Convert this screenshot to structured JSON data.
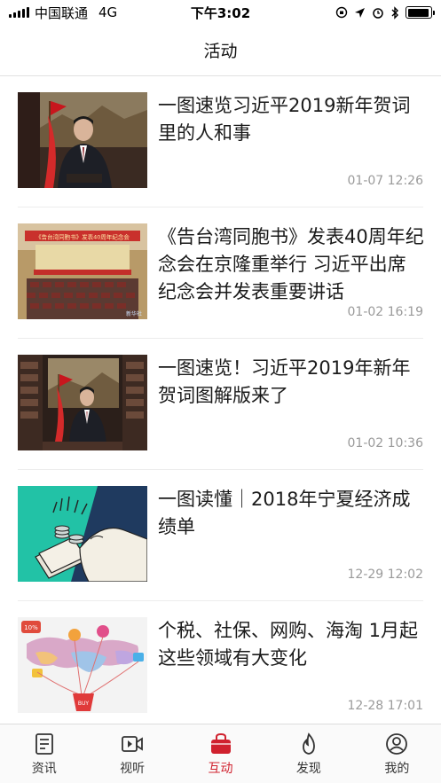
{
  "status_bar": {
    "carrier": "中国联通",
    "network": "4G",
    "time": "下午3:02",
    "battery_level": 0.95
  },
  "header": {
    "title": "活动"
  },
  "articles": [
    {
      "title": "一图速览习近平2019新年贺词里的人和事",
      "time": "01-07 12:26",
      "thumb_icon": "speech-photo"
    },
    {
      "title": "《告台湾同胞书》发表40周年纪念会在京隆重举行 习近平出席纪念会并发表重要讲话",
      "time": "01-02 16:19",
      "thumb_icon": "meeting-hall-photo",
      "thumb_banner": "《告台湾同胞书》发表40周年纪念会",
      "thumb_watermark": "新华社"
    },
    {
      "title": "一图速览！习近平2019年新年贺词图解版来了",
      "time": "01-02 10:36",
      "thumb_icon": "speech-photo"
    },
    {
      "title": "一图读懂｜2018年宁夏经济成绩单",
      "time": "12-29 12:02",
      "thumb_icon": "money-hand-illustration"
    },
    {
      "title": "个税、社保、网购、海淘 1月起这些领域有大变化",
      "time": "12-28 17:01",
      "thumb_icon": "world-map-shopping-illustration",
      "thumb_badge": "10%"
    }
  ],
  "tabs": [
    {
      "label": "资讯",
      "icon": "news-icon",
      "active": false
    },
    {
      "label": "视听",
      "icon": "video-icon",
      "active": false
    },
    {
      "label": "互动",
      "icon": "bag-icon",
      "active": true
    },
    {
      "label": "发现",
      "icon": "flame-icon",
      "active": false
    },
    {
      "label": "我的",
      "icon": "user-icon",
      "active": false
    }
  ],
  "colors": {
    "accent": "#d0212e",
    "divider": "#ececec",
    "time_text": "#9a9a9a",
    "flag_red": "#c8161d"
  }
}
